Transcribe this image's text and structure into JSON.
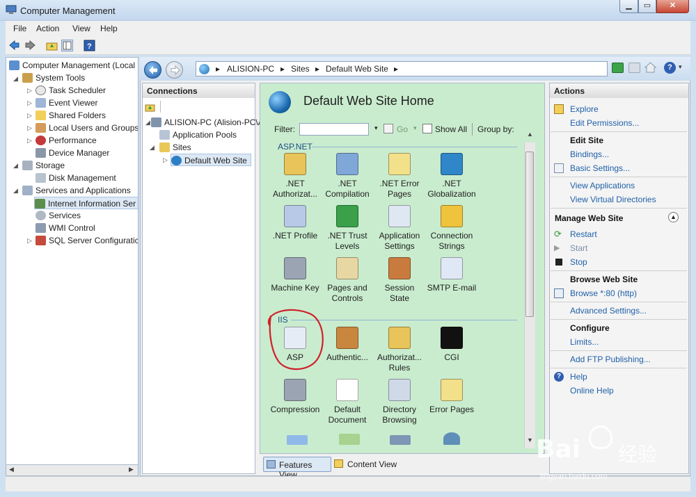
{
  "window": {
    "title": "Computer Management"
  },
  "menubar": {
    "items": [
      "File",
      "Action",
      "View",
      "Help"
    ]
  },
  "tree": {
    "items": [
      {
        "label": "Computer Management (Local"
      },
      {
        "label": "System Tools"
      },
      {
        "label": "Task Scheduler"
      },
      {
        "label": "Event Viewer"
      },
      {
        "label": "Shared Folders"
      },
      {
        "label": "Local Users and Groups"
      },
      {
        "label": "Performance"
      },
      {
        "label": "Device Manager"
      },
      {
        "label": "Storage"
      },
      {
        "label": "Disk Management"
      },
      {
        "label": "Services and Applications"
      },
      {
        "label": "Internet Information Ser"
      },
      {
        "label": "Services"
      },
      {
        "label": "WMI Control"
      },
      {
        "label": "SQL Server Configuratic"
      }
    ]
  },
  "address": {
    "crumbs": [
      "ALISION-PC",
      "Sites",
      "Default Web Site"
    ]
  },
  "connections": {
    "header": "Connections",
    "items": [
      {
        "label": "ALISION-PC (Alision-PC\\A"
      },
      {
        "label": "Application Pools"
      },
      {
        "label": "Sites"
      },
      {
        "label": "Default Web Site"
      }
    ]
  },
  "features": {
    "title": "Default Web Site Home",
    "filter_label": "Filter:",
    "go_label": "Go",
    "show_all_label": "Show All",
    "group_by_label": "Group by:",
    "sections": [
      {
        "name": "ASP.NET",
        "items": [
          {
            "label": ".NET Authorizat...",
            "icon": "lock-icon",
            "color": "#e8c45a"
          },
          {
            "label": ".NET Compilation",
            "icon": "compile-icon",
            "color": "#7fa7d8"
          },
          {
            "label": ".NET Error Pages",
            "icon": "error-404-icon",
            "color": "#f2e08a"
          },
          {
            "label": ".NET Globalization",
            "icon": "globe-icon",
            "color": "#2f86c8"
          },
          {
            "label": ".NET Profile",
            "icon": "profile-icon",
            "color": "#b7c9e6"
          },
          {
            "label": ".NET Trust Levels",
            "icon": "trust-icon",
            "color": "#3aa04a"
          },
          {
            "label": "Application Settings",
            "icon": "settings-list-icon",
            "color": "#dfe7f3"
          },
          {
            "label": "Connection Strings",
            "icon": "database-icon",
            "color": "#f0c33c"
          },
          {
            "label": "Machine Key",
            "icon": "key-icon",
            "color": "#9aa4b3"
          },
          {
            "label": "Pages and Controls",
            "icon": "pages-icon",
            "color": "#e7d7a3"
          },
          {
            "label": "Session State",
            "icon": "session-icon",
            "color": "#c97b3f"
          },
          {
            "label": "SMTP E-mail",
            "icon": "email-icon",
            "color": "#dfe8f4"
          }
        ]
      },
      {
        "name": "IIS",
        "items": [
          {
            "label": "ASP",
            "icon": "asp-icon",
            "color": "#e6ecf6"
          },
          {
            "label": "Authentic...",
            "icon": "authentication-icon",
            "color": "#c9863e"
          },
          {
            "label": "Authorizat... Rules",
            "icon": "authorization-rules-icon",
            "color": "#e8c45a"
          },
          {
            "label": "CGI",
            "icon": "cgi-icon",
            "color": "#111111"
          },
          {
            "label": "Compression",
            "icon": "compression-icon",
            "color": "#9aa4b3"
          },
          {
            "label": "Default Document",
            "icon": "default-document-icon",
            "color": "#ffffff"
          },
          {
            "label": "Directory Browsing",
            "icon": "directory-browsing-icon",
            "color": "#cfd9e8"
          },
          {
            "label": "Error Pages",
            "icon": "error-pages-icon",
            "color": "#f2e08a"
          }
        ]
      }
    ],
    "view_tabs": [
      "Features View",
      "Content View"
    ]
  },
  "actions": {
    "header": "Actions",
    "groups": [
      {
        "items": [
          "Explore",
          "Edit Permissions..."
        ]
      },
      {
        "title": "Edit Site",
        "items": [
          "Bindings...",
          "Basic Settings...",
          "View Applications",
          "View Virtual Directories"
        ]
      },
      {
        "title": "Manage Web Site",
        "items": [
          "Restart",
          "Start",
          "Stop"
        ]
      },
      {
        "title": "Browse Web Site",
        "items": [
          "Browse *:80 (http)",
          "Advanced Settings..."
        ]
      },
      {
        "title": "Configure",
        "items": [
          "Limits...",
          "Add FTP Publishing..."
        ]
      },
      {
        "items": [
          "Help",
          "Online Help"
        ]
      }
    ]
  },
  "watermark": {
    "line1": "Bai",
    "line2": "经验",
    "url": "jingyan.baidu.com"
  },
  "colors": {
    "link": "#2060a8",
    "feature_bg": "#c9ecce",
    "annotation": "#d0202a"
  }
}
